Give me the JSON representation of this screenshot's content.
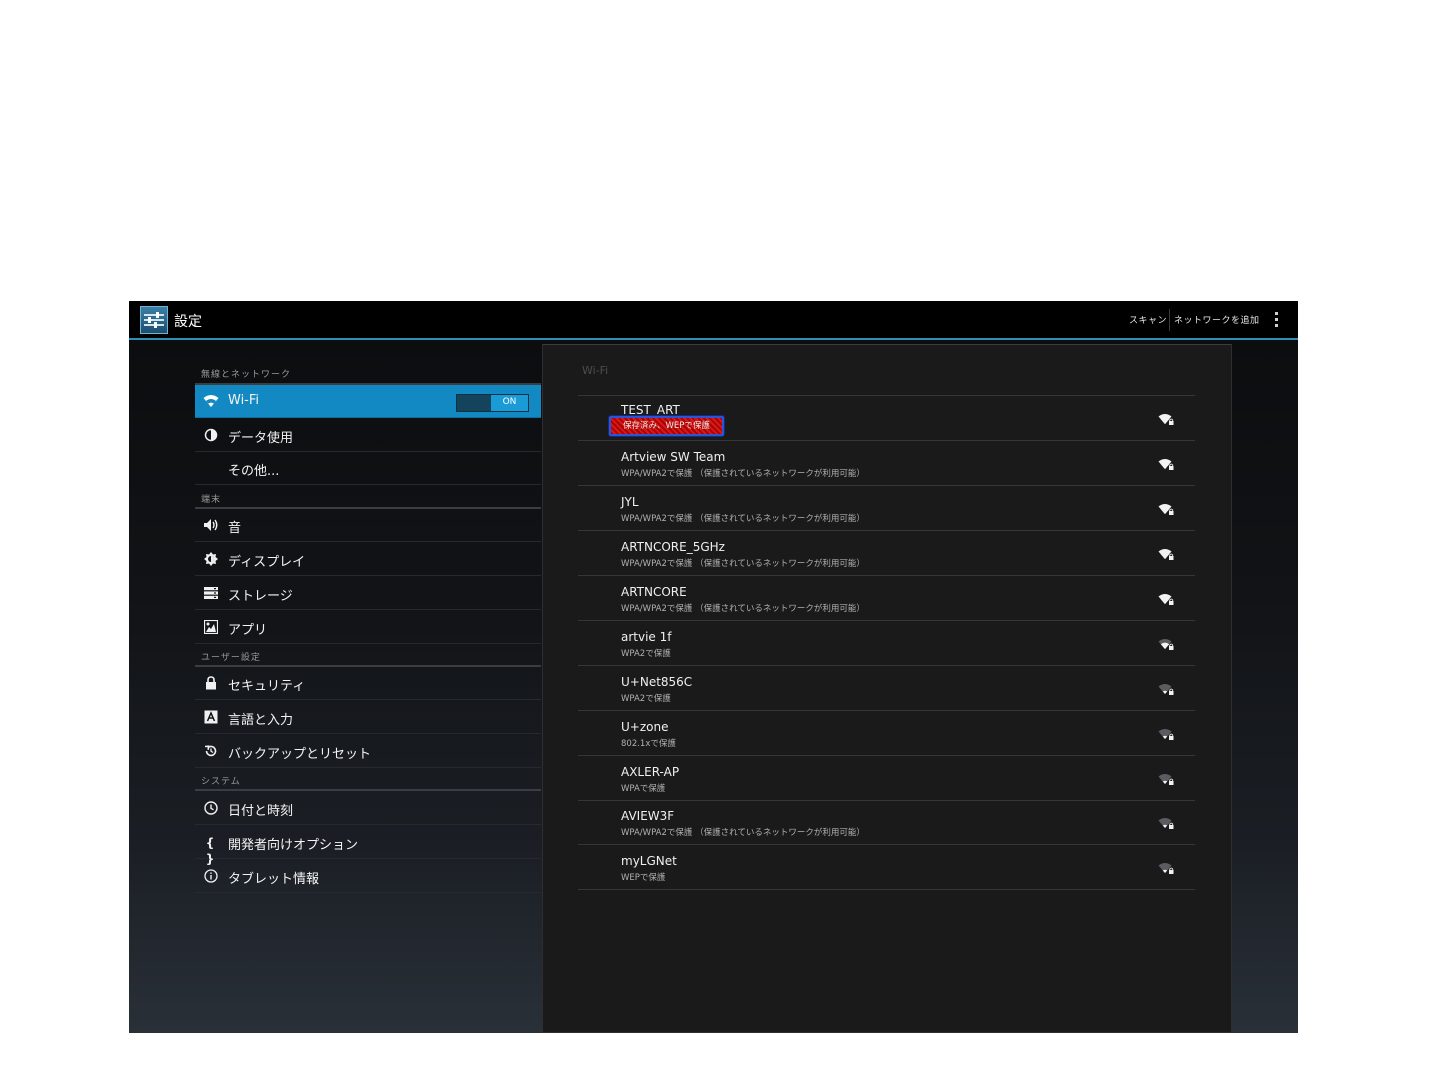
{
  "actionbar": {
    "title": "設定",
    "scan_label": "スキャン",
    "add_network_label": "ネットワークを追加"
  },
  "settings": {
    "sections": [
      {
        "header": "無線とネットワーク"
      },
      {
        "header": "端末"
      },
      {
        "header": "ユーザー設定"
      },
      {
        "header": "システム"
      }
    ],
    "items": [
      {
        "label": "Wi-Fi",
        "icon": "wifi-icon"
      },
      {
        "label": "データ使用",
        "icon": "data-usage-icon"
      },
      {
        "label": "その他...",
        "icon": ""
      },
      {
        "label": "音",
        "icon": "volume-icon"
      },
      {
        "label": "ディスプレイ",
        "icon": "brightness-icon"
      },
      {
        "label": "ストレージ",
        "icon": "storage-icon"
      },
      {
        "label": "アプリ",
        "icon": "apps-icon"
      },
      {
        "label": "セキュリティ",
        "icon": "lock-icon"
      },
      {
        "label": "言語と入力",
        "icon": "keyboard-icon"
      },
      {
        "label": "バックアップとリセット",
        "icon": "backup-icon"
      },
      {
        "label": "日付と時刻",
        "icon": "clock-icon"
      },
      {
        "label": "開発者向けオプション",
        "icon": "braces-icon"
      },
      {
        "label": "タブレット情報",
        "icon": "info-icon"
      }
    ],
    "wifi_toggle": "ON",
    "active_item": "Wi-Fi"
  },
  "wifi": {
    "title": "Wi-Fi",
    "networks": [
      {
        "ssid": "TEST_ART",
        "status": "保存済み、WEPで保護",
        "signal": 3
      },
      {
        "ssid": "Artview SW Team",
        "status": "WPA/WPA2で保護 （保護されているネットワークが利用可能）",
        "signal": 3
      },
      {
        "ssid": "JYL",
        "status": "WPA/WPA2で保護 （保護されているネットワークが利用可能）",
        "signal": 3
      },
      {
        "ssid": "ARTNCORE_5GHz",
        "status": "WPA/WPA2で保護 （保護されているネットワークが利用可能）",
        "signal": 3
      },
      {
        "ssid": "ARTNCORE",
        "status": "WPA/WPA2で保護 （保護されているネットワークが利用可能）",
        "signal": 3
      },
      {
        "ssid": "artvie 1f",
        "status": "WPA2で保護",
        "signal": 2
      },
      {
        "ssid": "U+Net856C",
        "status": "WPA2で保護",
        "signal": 1
      },
      {
        "ssid": "U+zone",
        "status": "802.1xで保護",
        "signal": 1
      },
      {
        "ssid": "AXLER-AP",
        "status": "WPAで保護",
        "signal": 1
      },
      {
        "ssid": "AVIEW3F",
        "status": "WPA/WPA2で保護 （保護されているネットワークが利用可能）",
        "signal": 1
      },
      {
        "ssid": "myLGNet",
        "status": "WEPで保護",
        "signal": 1
      }
    ]
  },
  "colors": {
    "accent": "#1289c2",
    "actionbar_underline": "#2f8fb8",
    "highlight_red": "#c41010",
    "highlight_border": "#2a55d8"
  }
}
